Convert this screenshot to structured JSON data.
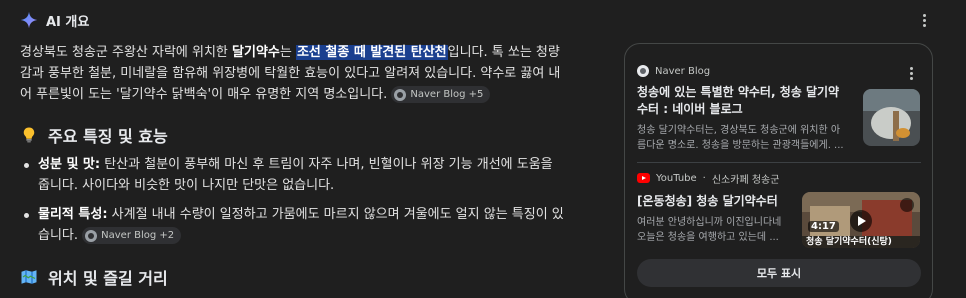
{
  "header": {
    "title": "AI 개요"
  },
  "intro": {
    "p1": "경상북도 청송군 주왕산 자락에 위치한 ",
    "b1": "달기약수",
    "p2": "는 ",
    "highlight": "조선 철종 때 발견된 탄산천",
    "p3": "입니다. 톡 쏘는 청량감과 풍부한 철분, 미네랄을 함유해 위장병에 탁월한 효능이 있다고 알려져 있습니다. 약수로 끓여 내어 푸른빛이 도는 '달기약수 닭백숙'이 매우 유명한 지역 명소입니다.",
    "chip": "Naver Blog +5"
  },
  "section1": {
    "title": "주요 특징 및 효능",
    "emoji": "lightbulb-icon"
  },
  "bullets": [
    {
      "label": "성분 및 맛:",
      "text": " 탄산과 철분이 풍부해 마신 후 트림이 자주 나며, 빈혈이나 위장 기능 개선에 도움을 줍니다. 사이다와 비슷한 맛이 나지만 단맛은 없습니다.",
      "chip": ""
    },
    {
      "label": "물리적 특성:",
      "text": " 사계절 내내 수량이 일정하고 가뭄에도 마르지 않으며 겨울에도 얼지 않는 특징이 있습니다.",
      "chip": "Naver Blog +2"
    }
  ],
  "section2": {
    "title": "위치 및 즐길 거리",
    "emoji": "map-icon"
  },
  "sources": {
    "card1": {
      "source": "Naver Blog",
      "title": "청송에 있는 특별한 약수터, 청송 달기약수터 : 네이버 블로그",
      "snippet": "청송 달기약수터는, 경상북도 청송군에 위치한 아름다운 명소로. 청송을 방문하는 관광객들에게. ..."
    },
    "card2": {
      "source": "YouTube",
      "channel": "신소카페 청송군",
      "title": "[온동청송] 청송 달기약수터",
      "snippet": "여러분 안녕하십니까 이진입니다네 오늘은 청송을 여행하고 있는데 ...",
      "duration": "4:17",
      "thumb_caption": "청송 달기약수터(신탕)"
    },
    "show_all": "모두 표시"
  },
  "colors": {
    "highlight_bg": "#1a3f8f",
    "bg": "#1f1f1f",
    "accent": "#4c8df6"
  }
}
